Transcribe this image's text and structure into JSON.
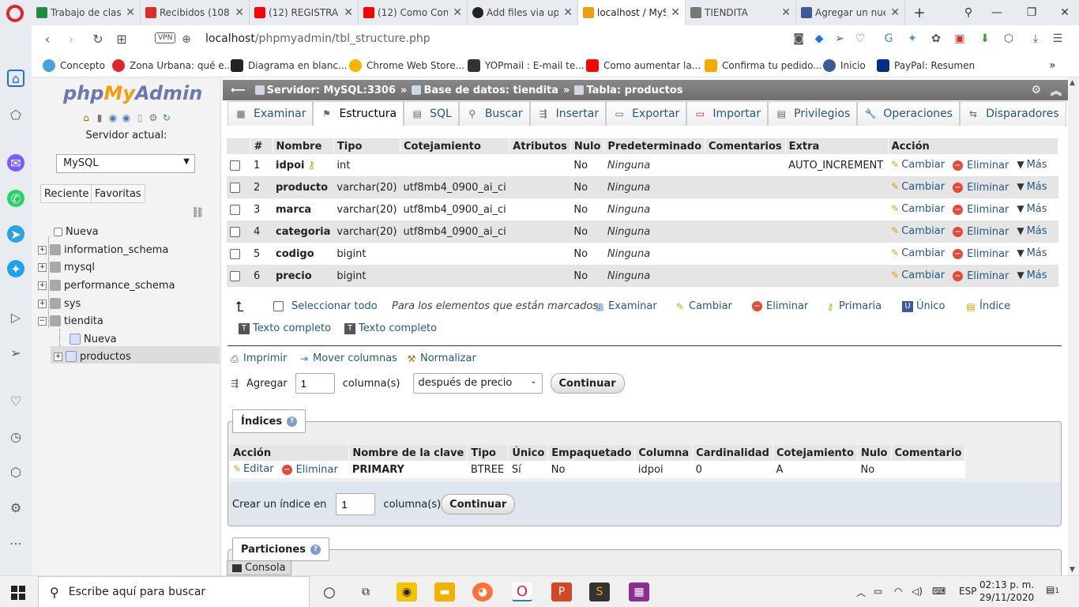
{
  "browser": {
    "tabs": [
      {
        "title": "Trabajo de clase",
        "color": "#1e8e3e"
      },
      {
        "title": "Recibidos (108)",
        "color": "#d93025"
      },
      {
        "title": "(12) REGISTRAR",
        "color": "#ff0000"
      },
      {
        "title": "(12) Como Cone",
        "color": "#ff0000"
      },
      {
        "title": "Add files via up",
        "color": "#222222"
      },
      {
        "title": "localhost / MyS",
        "color": "#f89c0e"
      },
      {
        "title": "TIENDITA",
        "color": "#777777"
      },
      {
        "title": "Agregar un nue",
        "color": "#3c5a99"
      }
    ],
    "new_tab_label": "+",
    "url_host": "localhost",
    "url_path": "/phpmyadmin/tbl_structure.php",
    "vpn_label": "VPN",
    "bookmarks": [
      {
        "label": "Concepto",
        "color": "#4aa3df"
      },
      {
        "label": "Zona Urbana: qué e...",
        "color": "#e0262b"
      },
      {
        "label": "Diagrama en blanc...",
        "color": "#222222"
      },
      {
        "label": "Chrome Web Store...",
        "color": "#f4b400"
      },
      {
        "label": "YOPmail : E-mail te...",
        "color": "#333333"
      },
      {
        "label": "Como aumentar la...",
        "color": "#ff0000"
      },
      {
        "label": "Confirma tu pedido...",
        "color": "#f5a800"
      },
      {
        "label": "Inicio",
        "color": "#3c5a99"
      },
      {
        "label": "PayPal: Resumen",
        "color": "#003087"
      }
    ],
    "bookmarks_more": "»"
  },
  "nav": {
    "logo_php": "php",
    "logo_my": "My",
    "logo_admin": "Admin",
    "server_label": "Servidor actual:",
    "server_value": "MySQL",
    "tab_recent": "Reciente",
    "tab_favorites": "Favoritas",
    "tree": [
      {
        "label": "Nueva"
      },
      {
        "label": "information_schema"
      },
      {
        "label": "mysql"
      },
      {
        "label": "performance_schema"
      },
      {
        "label": "sys"
      },
      {
        "label": "tiendita"
      },
      {
        "label": "Nueva"
      },
      {
        "label": "productos"
      }
    ]
  },
  "breadcrumb": {
    "server": "Servidor: MySQL:3306",
    "database": "Base de datos: tiendita",
    "table": "Tabla: productos",
    "sep": "»"
  },
  "tabs": [
    {
      "label": "Examinar",
      "icon": "▦"
    },
    {
      "label": "Estructura",
      "icon": "⚑"
    },
    {
      "label": "SQL",
      "icon": "▤"
    },
    {
      "label": "Buscar",
      "icon": "⚲"
    },
    {
      "label": "Insertar",
      "icon": "⇶"
    },
    {
      "label": "Exportar",
      "icon": "▭"
    },
    {
      "label": "Importar",
      "icon": "▭"
    },
    {
      "label": "Privilegios",
      "icon": "▤"
    },
    {
      "label": "Operaciones",
      "icon": "🔧"
    },
    {
      "label": "Disparadores",
      "icon": "⇆"
    }
  ],
  "structure": {
    "headers": [
      "#",
      "Nombre",
      "Tipo",
      "Cotejamiento",
      "Atributos",
      "Nulo",
      "Predeterminado",
      "Comentarios",
      "Extra",
      "Acción"
    ],
    "rows": [
      {
        "num": "1",
        "name": "idpoi",
        "type": "int",
        "collation": "",
        "attributes": "",
        "null": "No",
        "default": "Ninguna",
        "comments": "",
        "extra": "AUTO_INCREMENT"
      },
      {
        "num": "2",
        "name": "producto",
        "type": "varchar(20)",
        "collation": "utf8mb4_0900_ai_ci",
        "attributes": "",
        "null": "No",
        "default": "Ninguna",
        "comments": "",
        "extra": ""
      },
      {
        "num": "3",
        "name": "marca",
        "type": "varchar(20)",
        "collation": "utf8mb4_0900_ai_ci",
        "attributes": "",
        "null": "No",
        "default": "Ninguna",
        "comments": "",
        "extra": ""
      },
      {
        "num": "4",
        "name": "categoria",
        "type": "varchar(20)",
        "collation": "utf8mb4_0900_ai_ci",
        "attributes": "",
        "null": "No",
        "default": "Ninguna",
        "comments": "",
        "extra": ""
      },
      {
        "num": "5",
        "name": "codigo",
        "type": "bigint",
        "collation": "",
        "attributes": "",
        "null": "No",
        "default": "Ninguna",
        "comments": "",
        "extra": ""
      },
      {
        "num": "6",
        "name": "precio",
        "type": "bigint",
        "collation": "",
        "attributes": "",
        "null": "No",
        "default": "Ninguna",
        "comments": "",
        "extra": ""
      }
    ],
    "action_change": "Cambiar",
    "action_delete": "Eliminar",
    "action_more": "Más"
  },
  "bulk": {
    "select_all": "Seleccionar todo",
    "with_selected": "Para los elementos que están marcados:",
    "browse": "Examinar",
    "change": "Cambiar",
    "delete": "Eliminar",
    "primary": "Primaria",
    "unique": "Único",
    "index": "Índice",
    "fulltext1": "Texto completo",
    "fulltext2": "Texto completo"
  },
  "tools": {
    "print": "Imprimir",
    "move_columns": "Mover columnas",
    "normalize": "Normalizar",
    "add_label": "Agregar",
    "add_count": "1",
    "columns_label": "columna(s)",
    "position_value": "después de precio",
    "continue": "Continuar"
  },
  "indexes": {
    "legend": "Índices",
    "help": "?",
    "headers": [
      "Acción",
      "Nombre de la clave",
      "Tipo",
      "Único",
      "Empaquetado",
      "Columna",
      "Cardinalidad",
      "Cotejamiento",
      "Nulo",
      "Comentario"
    ],
    "row": {
      "edit": "Editar",
      "delete": "Eliminar",
      "key": "PRIMARY",
      "type": "BTREE",
      "unique": "Sí",
      "packed": "No",
      "column": "idpoi",
      "cardinality": "0",
      "collation": "A",
      "null": "No",
      "comment": ""
    },
    "create_label": "Crear un índice en",
    "create_count": "1",
    "columns_label": "columna(s)",
    "continue": "Continuar"
  },
  "partitions": {
    "legend": "Particiones",
    "help": "?"
  },
  "console": {
    "label": "Consola"
  },
  "taskbar": {
    "search_placeholder": "Escribe aquí para buscar",
    "lang": "ESP",
    "time": "02:13 p. m.",
    "date": "29/11/2020",
    "notifications": "1"
  }
}
